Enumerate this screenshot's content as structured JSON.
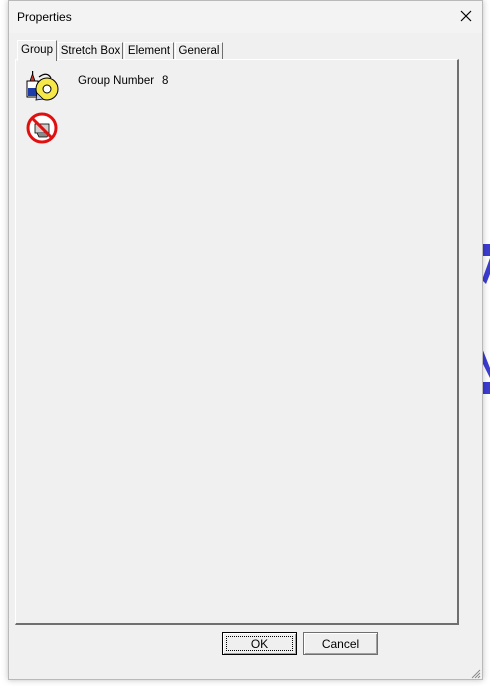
{
  "window": {
    "title": "Properties"
  },
  "tabs": [
    {
      "label": "Group",
      "active": true
    },
    {
      "label": "Stretch Box",
      "active": false
    },
    {
      "label": "Element",
      "active": false
    },
    {
      "label": "General",
      "active": false
    }
  ],
  "group_tab": {
    "group_number_label": "Group Number",
    "group_number_value": "8",
    "icons": [
      "group-icon",
      "ungroup-icon"
    ]
  },
  "buttons": {
    "ok": "OK",
    "cancel": "Cancel"
  },
  "colors": {
    "dialog_bg": "#f0f0f0",
    "background_accent": "#3c3cd2"
  }
}
